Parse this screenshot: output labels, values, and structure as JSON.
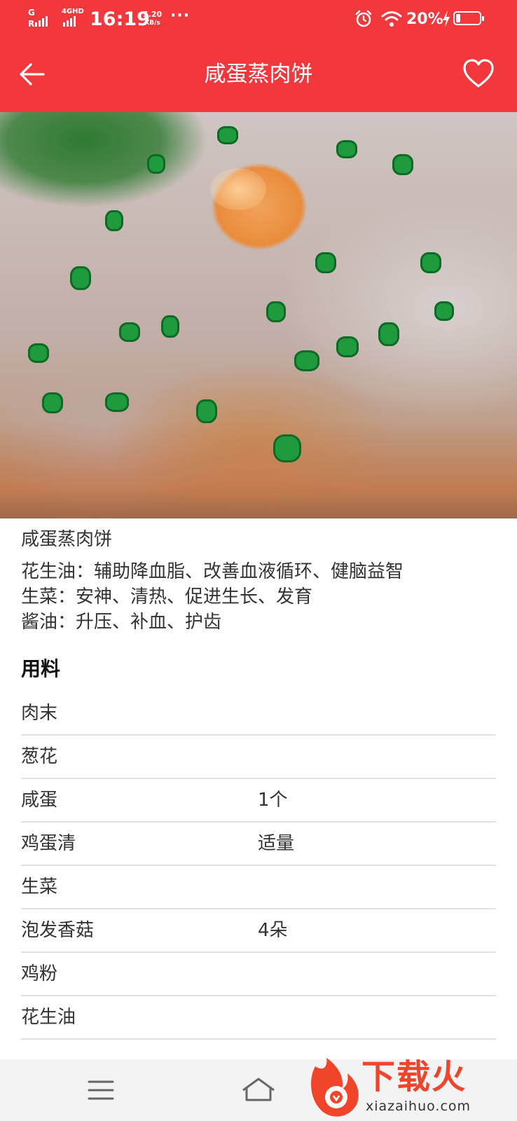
{
  "status_bar": {
    "network_top": "G",
    "network_bottom": "R",
    "network_4g": "4GHD",
    "time": "16:19",
    "speed_value": "5.20",
    "speed_unit": "KB/s",
    "more": "···",
    "battery_percent": "20%",
    "battery_level": 0.2,
    "icons": [
      "alarm-icon",
      "wifi-icon",
      "charging-icon",
      "battery-icon"
    ]
  },
  "app_bar": {
    "title": "咸蛋蒸肉饼",
    "back_icon": "arrow-left-icon",
    "favorite_icon": "heart-outline-icon",
    "background_color": "#f2373d"
  },
  "recipe": {
    "name": "咸蛋蒸肉饼",
    "benefits": [
      "花生油：辅助降血脂、改善血液循环、健脑益智",
      "生菜：安神、清热、促进生长、发育",
      "酱油：升压、补血、护齿"
    ],
    "ingredients_title": "用料",
    "ingredients": [
      {
        "name": "肉末",
        "qty": ""
      },
      {
        "name": "葱花",
        "qty": ""
      },
      {
        "name": "咸蛋",
        "qty": "1个"
      },
      {
        "name": "鸡蛋清",
        "qty": "适量"
      },
      {
        "name": "生菜",
        "qty": ""
      },
      {
        "name": "泡发香菇",
        "qty": "4朵"
      },
      {
        "name": "鸡粉",
        "qty": ""
      },
      {
        "name": "花生油",
        "qty": ""
      }
    ]
  },
  "bottom_nav": {
    "icons": [
      "menu-icon",
      "home-icon"
    ]
  },
  "watermark": {
    "text": "下载火",
    "sub": "xiazaihuo.com"
  }
}
